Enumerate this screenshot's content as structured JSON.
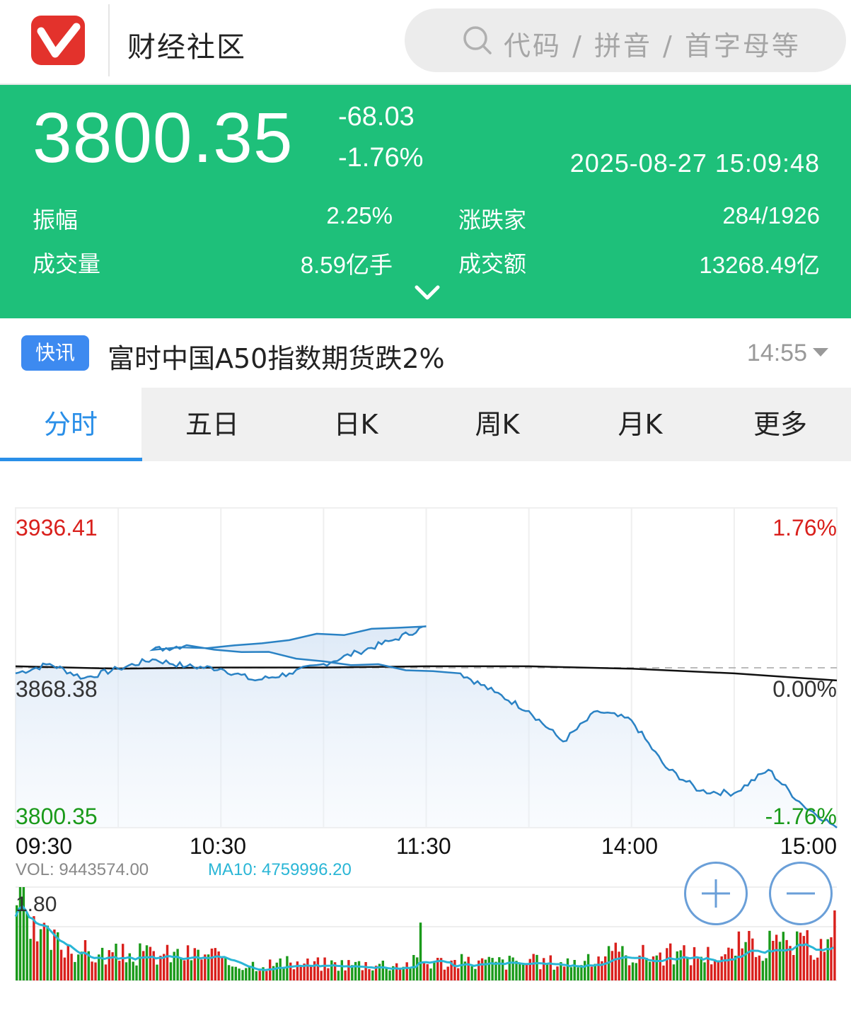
{
  "app": {
    "title": "财经社区",
    "search_placeholder": "代码 / 拼音 / 首字母等"
  },
  "quote": {
    "price": "3800.35",
    "change": "-68.03",
    "change_pct": "-1.76%",
    "datetime": "2025-08-27 15:09:48",
    "stats": [
      {
        "label": "振幅",
        "value": "2.25%"
      },
      {
        "label": "涨跌家",
        "value": "284/1926"
      },
      {
        "label": "成交量",
        "value": "8.59亿手"
      },
      {
        "label": "成交额",
        "value": "13268.49亿"
      }
    ]
  },
  "news": {
    "badge": "快讯",
    "headline": "富时中国A50指数期货跌2%",
    "time": "14:55"
  },
  "tabs": [
    "分时",
    "五日",
    "日K",
    "周K",
    "月K",
    "更多"
  ],
  "active_tab": "分时",
  "chart_labels": {
    "y_top": "3936.41",
    "y_mid": "3868.38",
    "y_bottom": "3800.35",
    "pct_top": "1.76%",
    "pct_mid": "0.00%",
    "pct_bottom": "-1.76%",
    "x_ticks": [
      "09:30",
      "10:30",
      "11:30",
      "14:00",
      "15:00"
    ],
    "vol": "VOL: 9443574.00",
    "ma10": "MA10: 4759996.20",
    "vol_axis": "1.80"
  },
  "zoom": {
    "in": "+",
    "out": "−"
  },
  "colors": {
    "green_header": "#1ec07a",
    "accent_blue": "#2a8fe8",
    "up_red": "#d9201c",
    "down_green": "#1a9a1a",
    "price_line": "#2a82c4",
    "avg_line": "#111111"
  },
  "chart_data": {
    "type": "line",
    "x_ticks": [
      "09:30",
      "10:30",
      "11:30",
      "14:00",
      "15:00"
    ],
    "ylim": [
      3800.35,
      3936.41
    ],
    "baseline": 3868.38,
    "series": [
      {
        "x": [
          "09:30",
          "09:40",
          "09:50",
          "10:00",
          "10:10",
          "10:20",
          "10:30",
          "10:40",
          "10:50",
          "11:00",
          "11:10",
          "11:20",
          "11:30",
          "11:40",
          "11:50",
          "13:10",
          "13:20",
          "13:30",
          "13:40",
          "13:50",
          "14:00",
          "14:10",
          "14:20",
          "14:30",
          "14:40",
          "14:50",
          "15:00"
        ],
        "values": [
          3866,
          3870,
          3864,
          3868,
          3872,
          3869,
          3868,
          3863,
          3866,
          3870,
          3875,
          3880,
          3886,
          3876,
          3878,
          3866,
          3858,
          3850,
          3837,
          3850,
          3846,
          3826,
          3816,
          3815,
          3825,
          3810,
          3800.35
        ]
      },
      {
        "x": [
          "09:30",
          "10:00",
          "10:30",
          "11:00",
          "11:30",
          "13:30",
          "14:00",
          "14:30",
          "15:00"
        ],
        "values": [
          3869,
          3868,
          3868.5,
          3868.5,
          3869,
          3869,
          3868,
          3866,
          3863
        ]
      }
    ]
  }
}
